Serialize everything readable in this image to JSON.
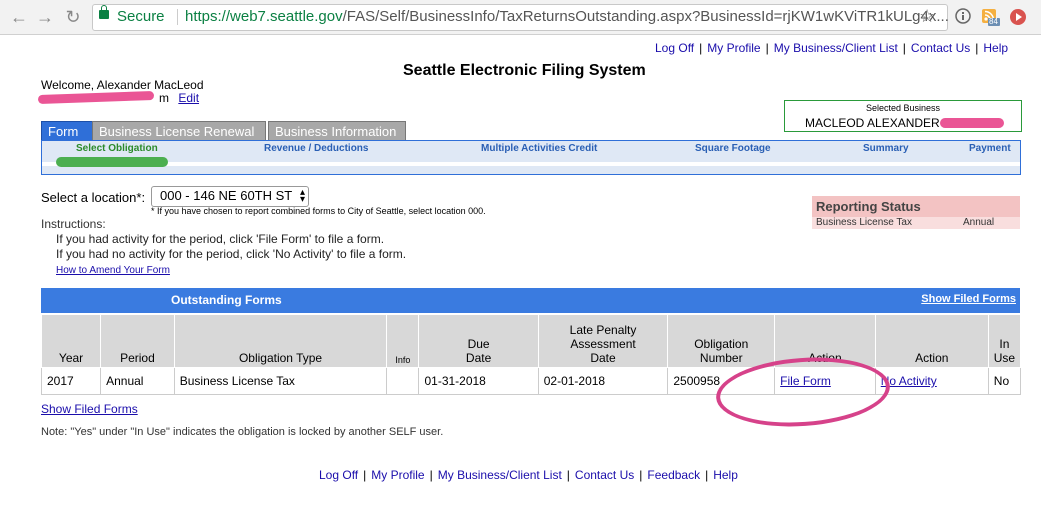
{
  "browser": {
    "secure_label": "Secure",
    "url_host": "https://web7.seattle.gov",
    "url_rest": "/FAS/Self/BusinessInfo/TaxReturnsOutstanding.aspx?BusinessId=rjKW1wKViTR1kULg4x...",
    "badge_count": "84"
  },
  "header": {
    "top_links": [
      "Log Off",
      "My Profile",
      "My Business/Client List",
      "Contact Us",
      "Help"
    ],
    "title": "Seattle Electronic Filing System",
    "welcome": "Welcome, Alexander MacLeod",
    "email_suffix": "m",
    "edit_link": "Edit"
  },
  "selected_business": {
    "label": "Selected Business",
    "value": "MACLEOD ALEXANDER"
  },
  "tabs": [
    "Form",
    "Business License Renewal",
    "Business Information"
  ],
  "steps": [
    "Select Obligation",
    "Revenue / Deductions",
    "Multiple Activities Credit",
    "Square Footage",
    "Summary",
    "Payment"
  ],
  "location": {
    "label": "Select a location*:",
    "selected": "000 - 146 NE 60TH ST",
    "note": "* If you have chosen to report combined forms to City of Seattle, select location 000."
  },
  "instructions": {
    "heading": "Instructions:",
    "line1": "If you had activity for the period, click 'File Form' to file a form.",
    "line2": "If you had no activity for the period, click 'No Activity' to file a form.",
    "amend_link": "How to Amend Your Form"
  },
  "reporting_status": {
    "title": "Reporting Status",
    "tax": "Business License Tax",
    "frequency": "Annual"
  },
  "outstanding": {
    "title": "Outstanding Forms",
    "show_filed": "Show Filed Forms",
    "columns": {
      "year": "Year",
      "period": "Period",
      "type": "Obligation Type",
      "info": "Info",
      "due1": "Due",
      "due2": "Date",
      "late1": "Late Penalty",
      "late2": "Assessment",
      "late3": "Date",
      "obl1": "Obligation",
      "obl2": "Number",
      "action": "Action",
      "action2": "Action",
      "inuse1": "In",
      "inuse2": "Use"
    },
    "row": {
      "year": "2017",
      "period": "Annual",
      "type": "Business License Tax",
      "due": "01-31-2018",
      "late": "02-01-2018",
      "number": "2500958",
      "file": "File Form",
      "noact": "No Activity",
      "inuse": "No"
    }
  },
  "footer": {
    "show_filed": "Show Filed Forms",
    "note": "Note: \"Yes\" under \"In Use\" indicates the obligation is locked by another SELF user.",
    "links": [
      "Log Off",
      "My Profile",
      "My Business/Client List",
      "Contact Us",
      "Feedback",
      "Help"
    ]
  }
}
